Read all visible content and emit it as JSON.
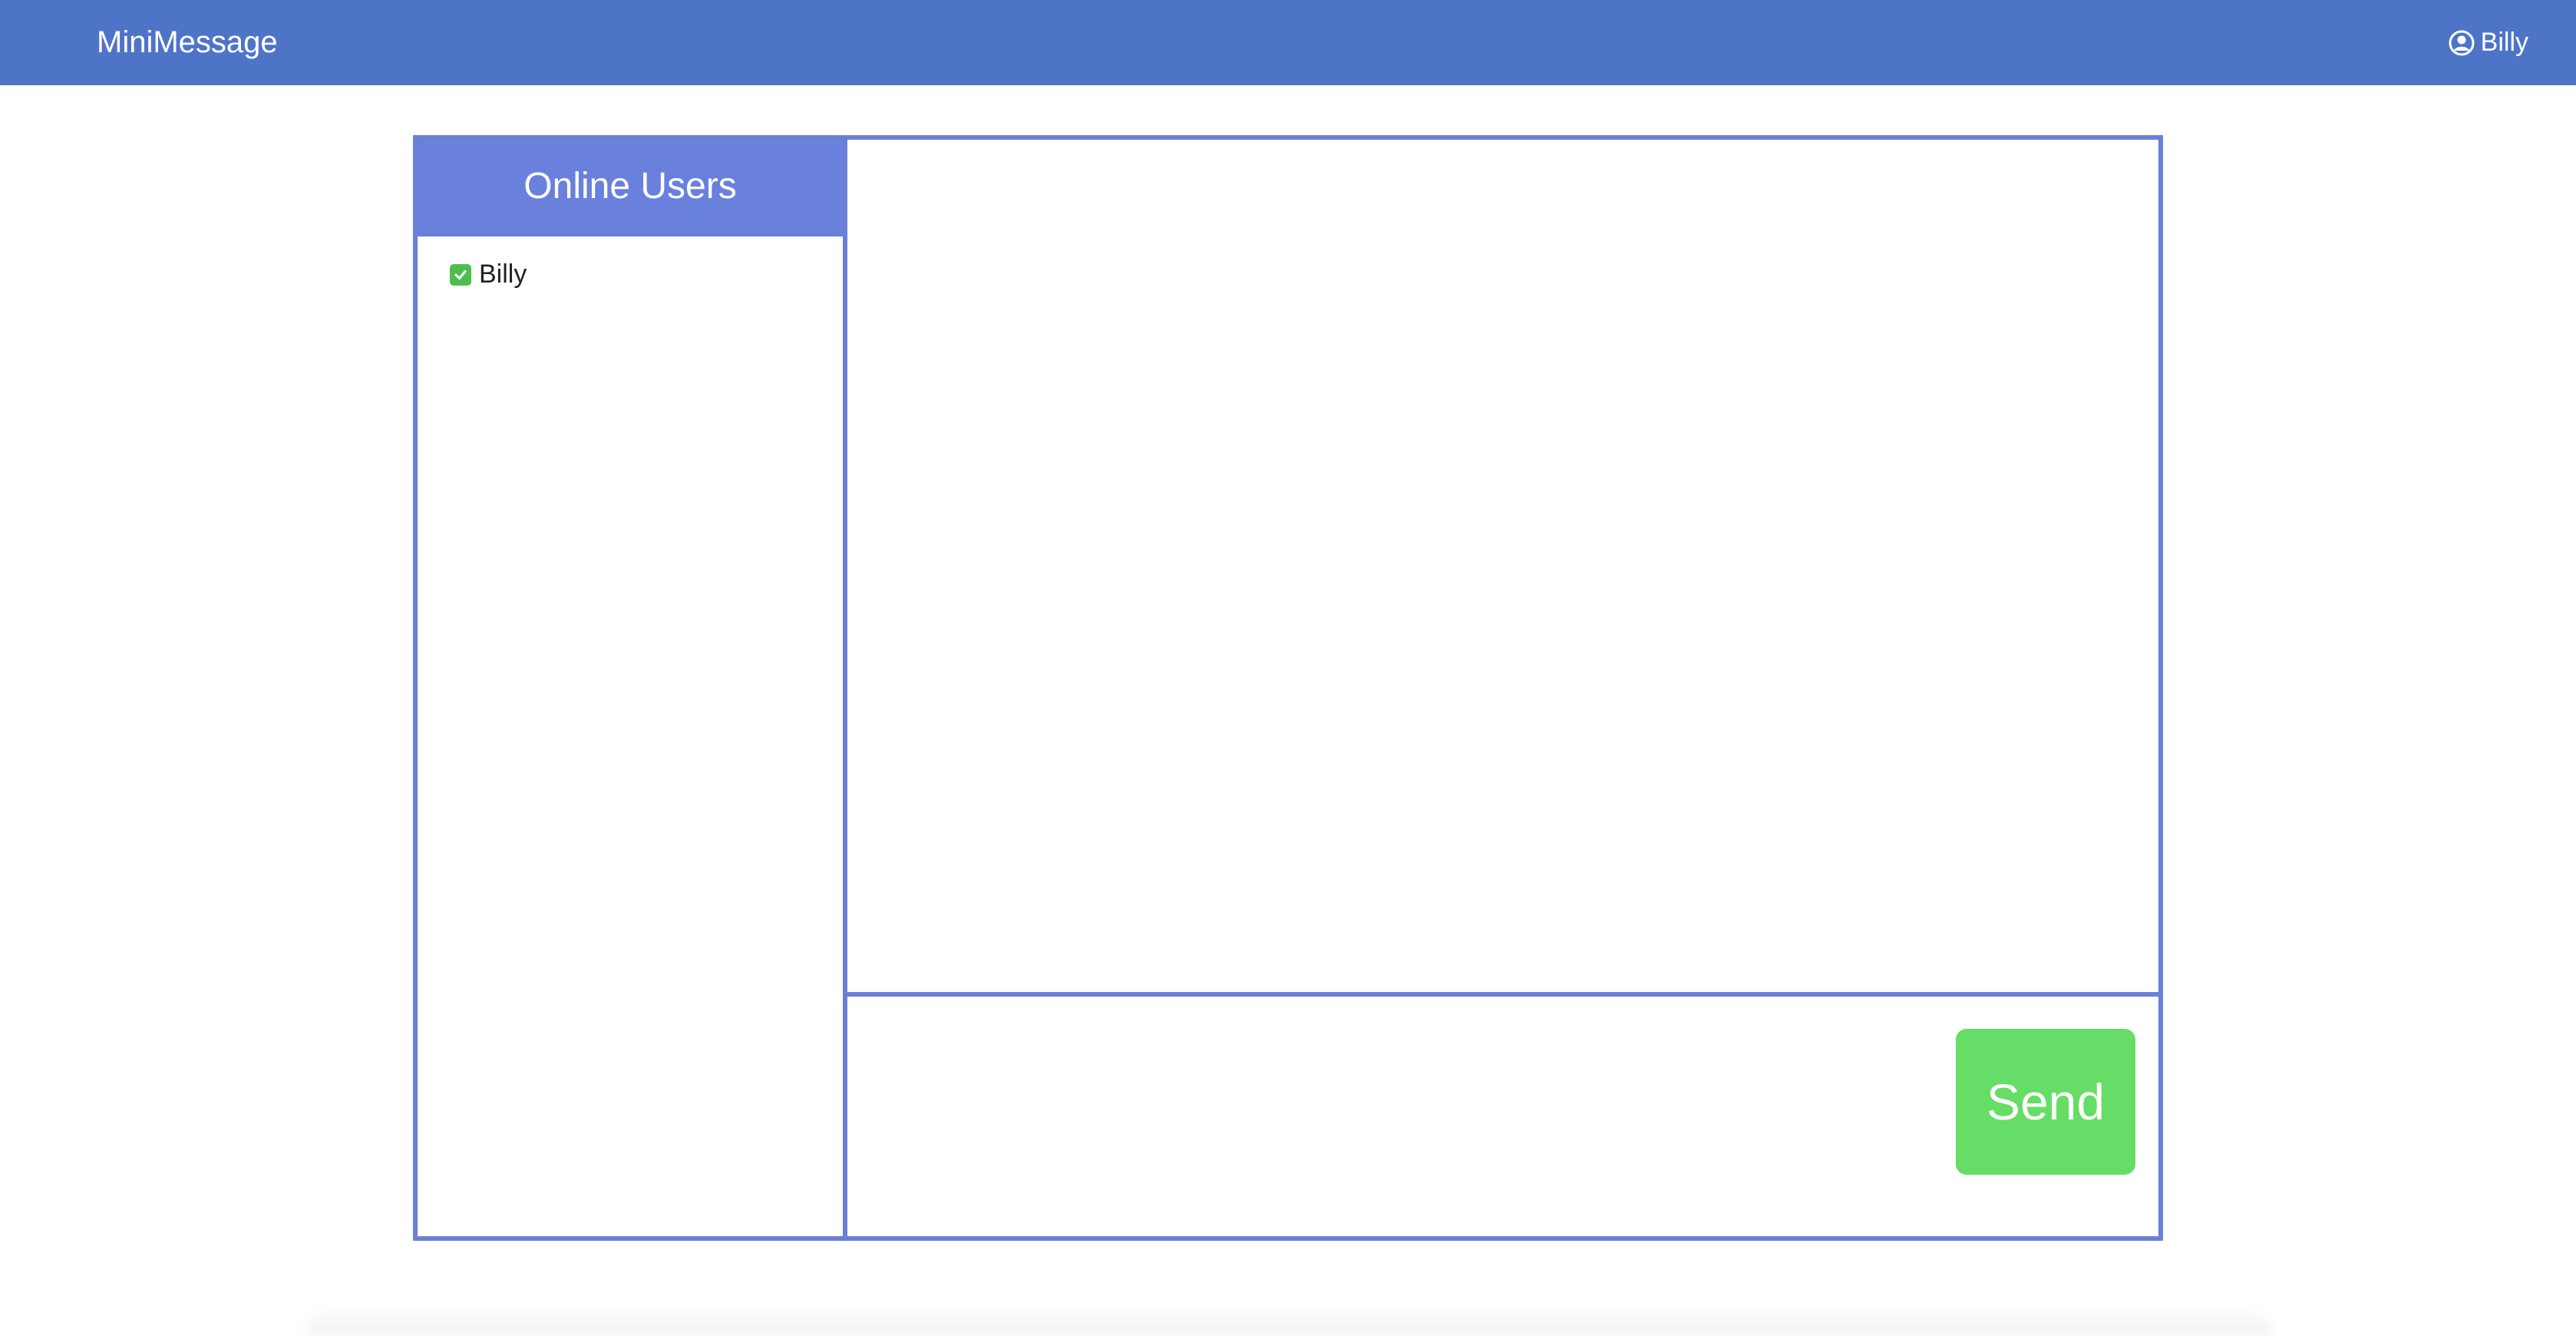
{
  "navbar": {
    "brand": "MiniMessage",
    "user_name": "Billy",
    "user_icon": "user-circle-icon",
    "background_color": "#4e74c8"
  },
  "users_panel": {
    "title": "Online Users",
    "users": [
      {
        "name": "Billy",
        "online": true,
        "status_icon": "check-square-icon"
      }
    ]
  },
  "messages": [],
  "composer": {
    "input_value": "",
    "send_label": "Send",
    "send_color": "#66dd66"
  },
  "colors": {
    "frame_border": "#6a80d8",
    "header_fill": "#6a80dd",
    "online_check": "#4cbe4c"
  }
}
